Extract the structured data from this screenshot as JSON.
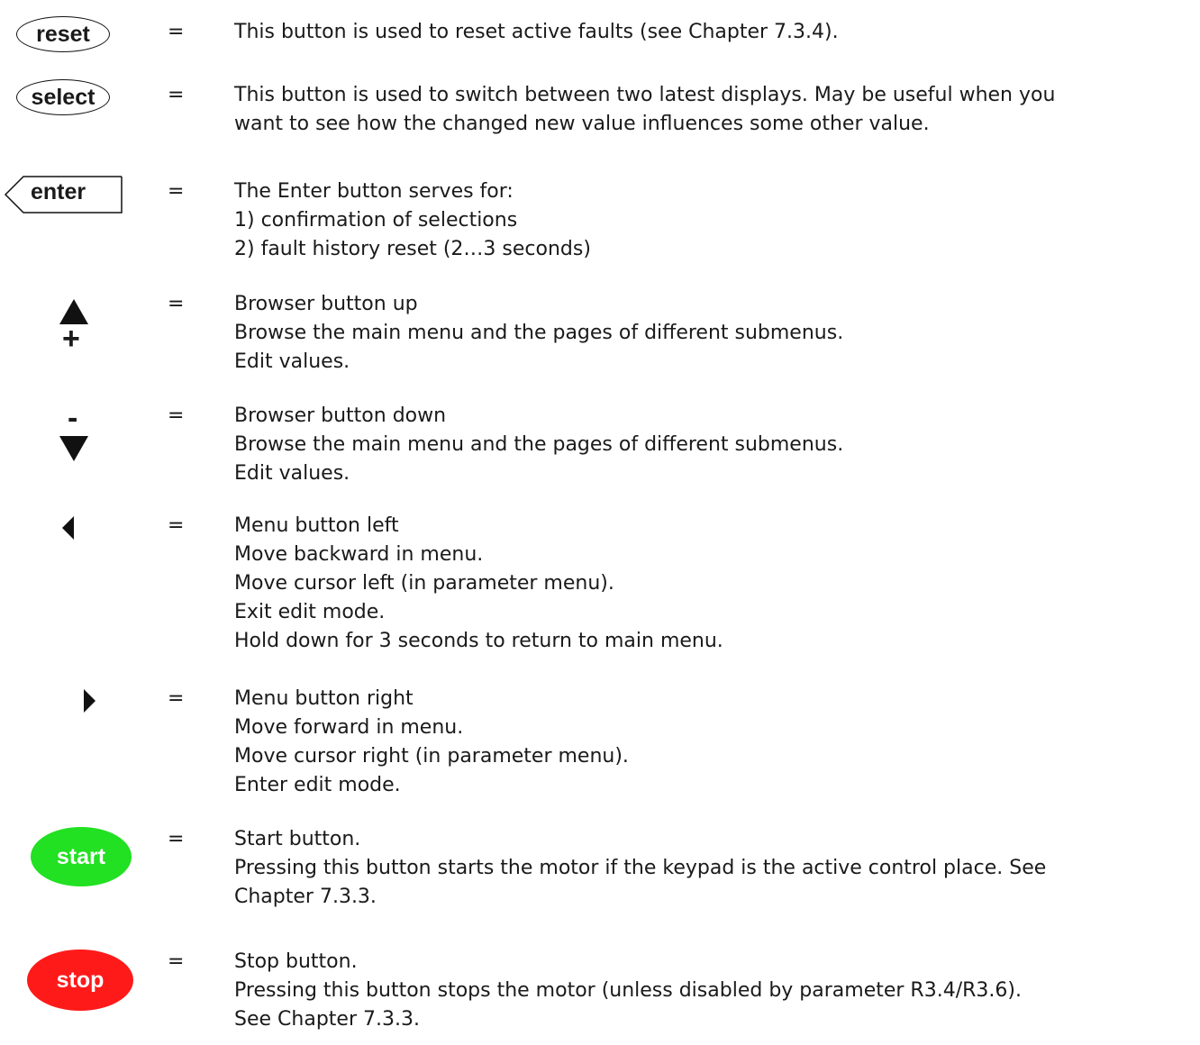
{
  "equals_sign": "=",
  "buttons": [
    {
      "label": "reset",
      "icon": "reset-button-icon",
      "lines": [
        "This button is used to reset active faults (see Chapter 7.3.4)."
      ]
    },
    {
      "label": "select",
      "icon": "select-button-icon",
      "lines": [
        "This button is used to switch between two latest displays. May be useful when you",
        "want to see how the changed new value influences some other value."
      ]
    },
    {
      "label": "enter",
      "icon": "enter-button-icon",
      "lines": [
        "The Enter button serves for:",
        "1) confirmation of selections",
        "2) fault history reset (2…3 seconds)"
      ]
    },
    {
      "label": "+",
      "icon": "arrow-up-plus-icon",
      "lines": [
        "Browser button up",
        "Browse the main menu and the pages of different submenus.",
        "Edit values."
      ]
    },
    {
      "label": "-",
      "icon": "arrow-down-minus-icon",
      "lines": [
        "Browser button down",
        "Browse the main menu and the pages of different submenus.",
        "Edit values."
      ]
    },
    {
      "label": "",
      "icon": "arrow-left-icon",
      "lines": [
        "Menu button left",
        "Move backward in menu.",
        "Move cursor left (in parameter menu).",
        "Exit edit mode.",
        "Hold down for 3 seconds to return to main menu."
      ]
    },
    {
      "label": "",
      "icon": "arrow-right-icon",
      "lines": [
        "Menu button right",
        "Move forward in menu.",
        "Move cursor right (in parameter menu).",
        "Enter edit mode."
      ]
    },
    {
      "label": "start",
      "icon": "start-button-icon",
      "color": "#22e022",
      "lines": [
        "Start button.",
        "Pressing this button starts the motor if the keypad is the active control place. See",
        "Chapter 7.3.3."
      ]
    },
    {
      "label": "stop",
      "icon": "stop-button-icon",
      "color": "#ff1a1a",
      "lines": [
        "Stop button.",
        "Pressing this button stops the motor (unless disabled by parameter R3.4/R3.6).",
        "See Chapter 7.3.3."
      ]
    }
  ]
}
